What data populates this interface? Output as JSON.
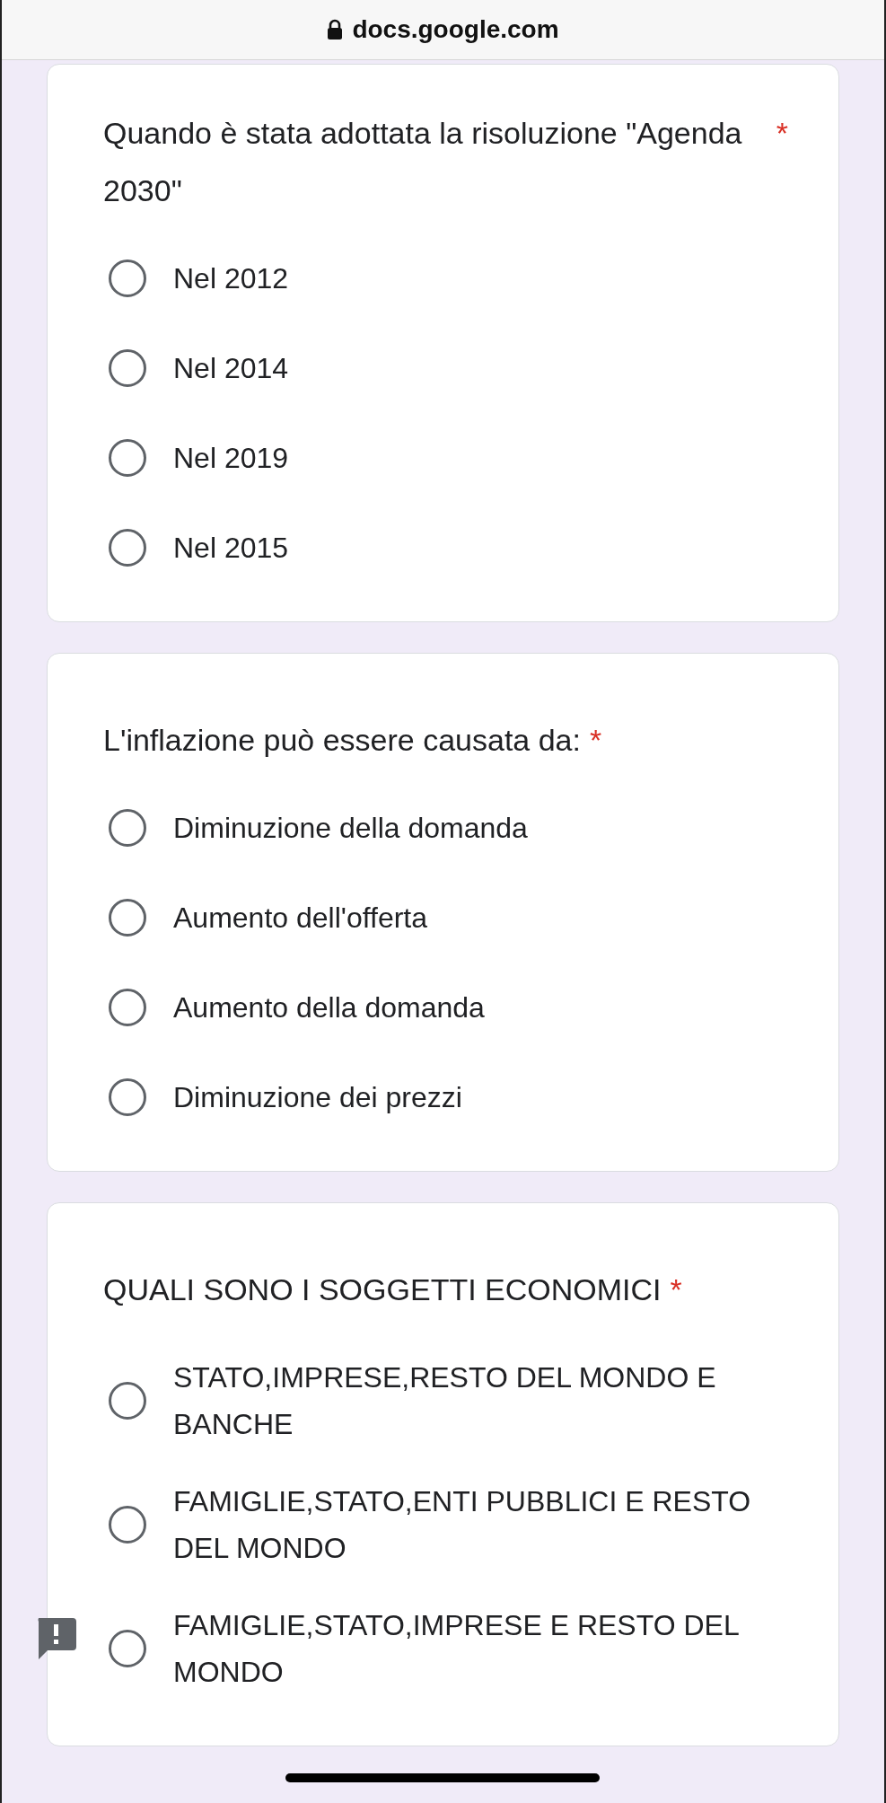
{
  "address_bar": {
    "url": "docs.google.com",
    "secure": true
  },
  "questions": [
    {
      "title": "Quando è stata adottata la risoluzione \"Agenda 2030\"",
      "required_mark": "*",
      "options": [
        {
          "label": "Nel 2012",
          "selected": false,
          "flagged": false
        },
        {
          "label": "Nel 2014",
          "selected": false,
          "flagged": false
        },
        {
          "label": "Nel 2019",
          "selected": false,
          "flagged": false
        },
        {
          "label": "Nel 2015",
          "selected": false,
          "flagged": false
        }
      ]
    },
    {
      "title": "L'inflazione può essere causata da:",
      "required_mark": "*",
      "options": [
        {
          "label": "Diminuzione della domanda",
          "selected": false,
          "flagged": false
        },
        {
          "label": "Aumento dell'offerta",
          "selected": false,
          "flagged": false
        },
        {
          "label": "Aumento della domanda",
          "selected": false,
          "flagged": false
        },
        {
          "label": "Diminuzione dei prezzi",
          "selected": false,
          "flagged": false
        }
      ]
    },
    {
      "title": "QUALI SONO I SOGGETTI ECONOMICI",
      "required_mark": "*",
      "options": [
        {
          "label": "STATO,IMPRESE,RESTO DEL MONDO E BANCHE",
          "selected": false,
          "flagged": false
        },
        {
          "label": "FAMIGLIE,STATO,ENTI PUBBLICI E RESTO DEL MONDO",
          "selected": false,
          "flagged": false
        },
        {
          "label": "FAMIGLIE,STATO,IMPRESE E RESTO DEL MONDO",
          "selected": false,
          "flagged": true
        }
      ]
    }
  ]
}
